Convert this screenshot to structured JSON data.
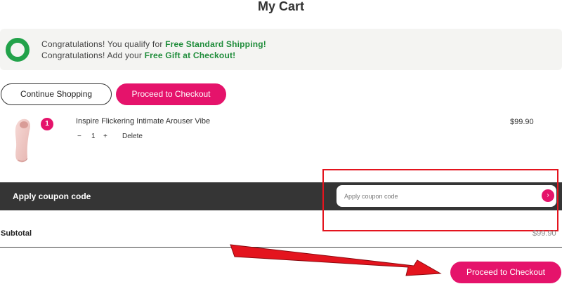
{
  "page": {
    "title": "My Cart"
  },
  "banner": {
    "line1_prefix": "Congratulations! You qualify for ",
    "line1_highlight": "Free Standard Shipping!",
    "line2_prefix": "Congratulations! Add your ",
    "line2_highlight": "Free Gift at Checkout!",
    "progress_color": "#22a24a"
  },
  "actions": {
    "continue_label": "Continue Shopping",
    "checkout_label": "Proceed to Checkout"
  },
  "cart": {
    "items": [
      {
        "badge": "1",
        "name": "Inspire Flickering Intimate Arouser Vibe",
        "qty_minus": "−",
        "qty": "1",
        "qty_plus": "+",
        "delete_label": "Delete",
        "price": "$99.90"
      }
    ]
  },
  "coupon": {
    "label": "Apply coupon code",
    "placeholder": "Apply coupon code",
    "submit_icon": "›"
  },
  "summary": {
    "subtotal_label": "Subtotal",
    "subtotal_value": "$99.90"
  },
  "footer": {
    "checkout_label": "Proceed to Checkout"
  },
  "colors": {
    "accent": "#e5136b",
    "annotation": "#e4141e",
    "coupon_bar": "#353535"
  }
}
